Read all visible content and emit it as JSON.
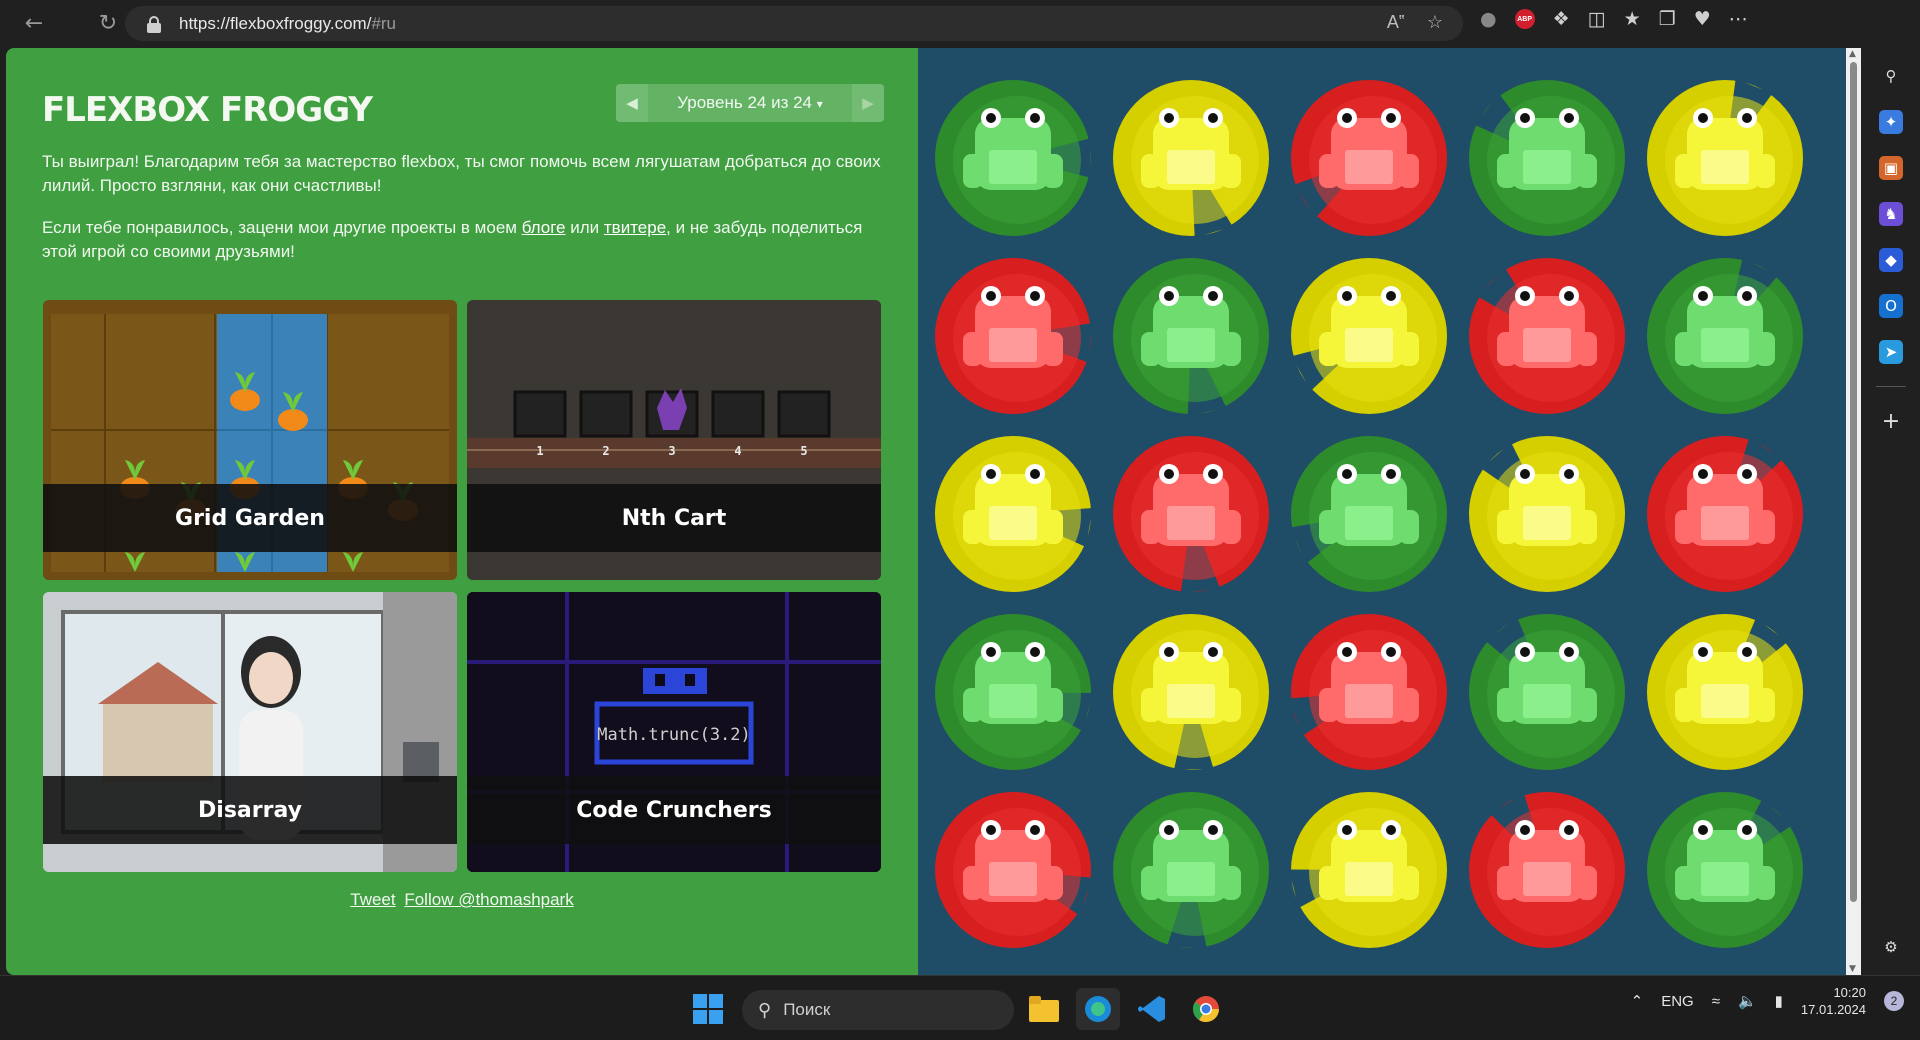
{
  "browser": {
    "url_host": "https://flexboxfroggy.com/",
    "url_rest": "#ru"
  },
  "game": {
    "logo": "FLEXBOX FROGGY",
    "level_label": "Уровень 24 из 24",
    "level_dropdown": "▾",
    "prev_arrow": "◀",
    "next_arrow": "▶",
    "win_text": "Ты выиграл! Благодарим тебя за мастерство flexbox, ты смог помочь всем лягушатам добраться до своих лилий. Просто взгляни, как они счастливы!",
    "promo_before": "Если тебе понравилось, зацени мои другие проекты в моем ",
    "promo_blog": "блоге",
    "promo_or": " или ",
    "promo_twitter": "твитере",
    "promo_after": ", и не забудь поделиться этой игрой со своими друзьями!",
    "cards": [
      {
        "title": "Grid Garden"
      },
      {
        "title": "Nth Cart"
      },
      {
        "title": "Disarray"
      },
      {
        "title": "Code Crunchers"
      }
    ],
    "code_cruncher_text": "Math.trunc(3.2)",
    "cart_numbers": [
      "1",
      "2",
      "3",
      "4",
      "5"
    ],
    "tweet_link": "Tweet",
    "follow_link": "Follow @thomashpark",
    "frog_grid": [
      [
        "green",
        "yellow",
        "red",
        "green",
        "yellow"
      ],
      [
        "red",
        "green",
        "yellow",
        "red",
        "green"
      ],
      [
        "yellow",
        "red",
        "green",
        "yellow",
        "red"
      ],
      [
        "green",
        "yellow",
        "red",
        "green",
        "yellow"
      ],
      [
        "red",
        "green",
        "yellow",
        "red",
        "green"
      ]
    ]
  },
  "colors": {
    "page_green": "#3f9f41",
    "pond_blue": "#1f4c66",
    "green_pad": "#2e8b2c",
    "green_frog": "#6fdc6f",
    "yellow_pad": "#d6cf00",
    "yellow_frog": "#f5f53a",
    "red_pad": "#d81f1f",
    "red_frog": "#ff6b6b"
  },
  "taskbar": {
    "search_placeholder": "Поиск",
    "language": "ENG",
    "time": "10:20",
    "date": "17.01.2024",
    "notification_count": "2"
  }
}
